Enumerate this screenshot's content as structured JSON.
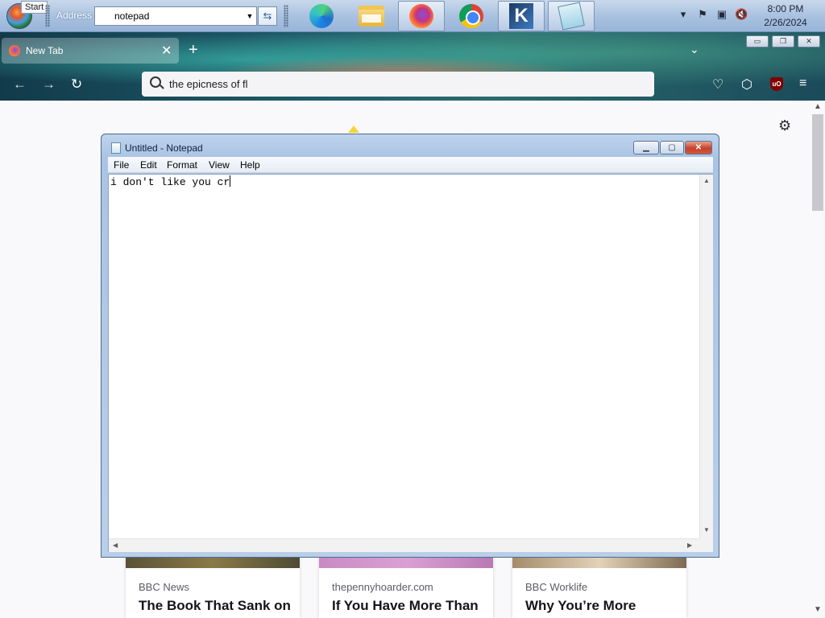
{
  "taskbar": {
    "start_tooltip": "Start",
    "address_label": "Address",
    "address_value": "notepad",
    "go_icon": "go-arrows-icon",
    "apps": [
      "edge-icon",
      "file-explorer-icon",
      "firefox-icon",
      "chrome-icon",
      "kodi-icon",
      "notepad-icon"
    ],
    "clock_time": "8:00 PM",
    "clock_date": "2/26/2024"
  },
  "browser": {
    "tab_title": "New Tab",
    "tab_close": "✕",
    "new_tab": "+",
    "url_text": "the epicness of fl",
    "window_controls": [
      "▭",
      "❐",
      "✕"
    ],
    "cards": [
      {
        "source": "BBC News",
        "title": "The Book That Sank on"
      },
      {
        "source": "thepennyhoarder.com",
        "title": "If You Have More Than"
      },
      {
        "source": "BBC Worklife",
        "title": "Why You’re More"
      }
    ]
  },
  "notepad": {
    "title": "Untitled - Notepad",
    "menus": [
      "File",
      "Edit",
      "Format",
      "View",
      "Help"
    ],
    "content": "i don't like you cr"
  },
  "colors": {
    "taskbar": "#aac2e0",
    "notepad_frame": "#a9c3e4",
    "close_red": "#c7402a"
  }
}
